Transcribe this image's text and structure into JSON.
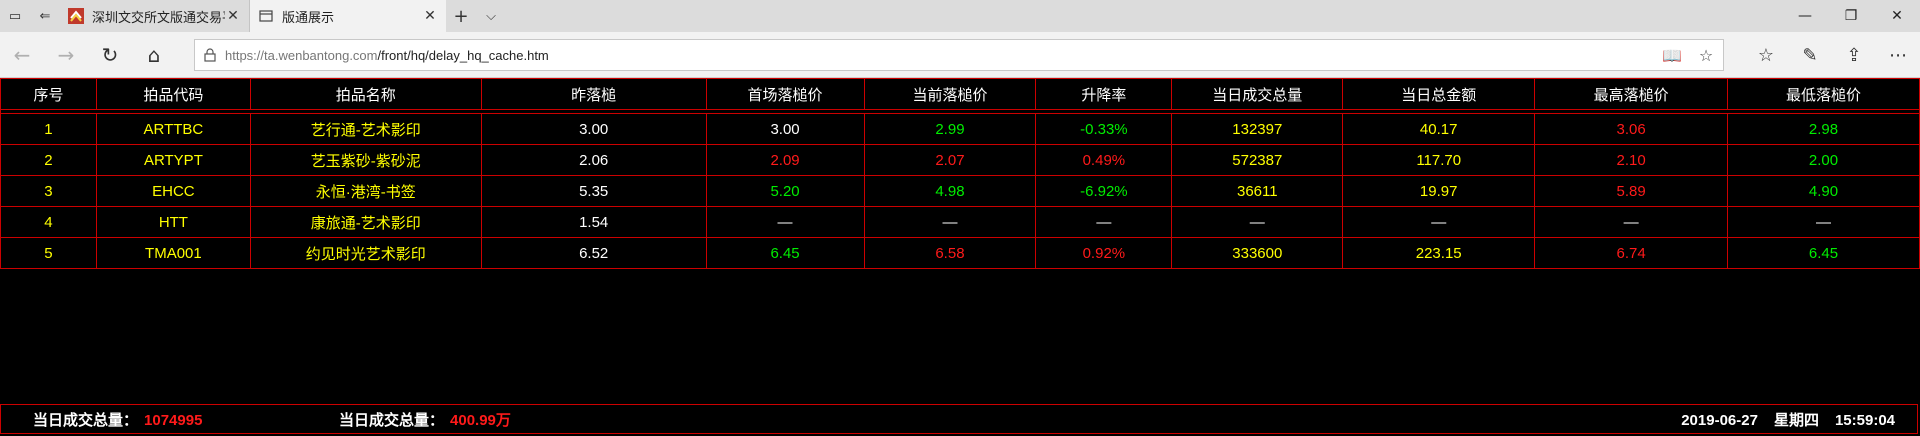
{
  "browser": {
    "tabs": [
      {
        "title": "深圳文交所文版通交易平台",
        "active": false
      },
      {
        "title": "版通展示",
        "active": true
      }
    ],
    "url_host": "https://ta.wenbantong.com",
    "url_path": "/front/hq/delay_hq_cache.htm"
  },
  "table": {
    "headers": [
      "序号",
      "拍品代码",
      "拍品名称",
      "昨落槌",
      "首场落槌价",
      "当前落槌价",
      "升降率",
      "当日成交总量",
      "当日总金额",
      "最高落槌价",
      "最低落槌价"
    ],
    "rows": [
      {
        "cells": [
          "1",
          "ARTTBC",
          "艺行通-艺术影印",
          "3.00",
          "3.00",
          "2.99",
          "-0.33%",
          "132397",
          "40.17",
          "3.06",
          "2.98"
        ],
        "colors": [
          "y",
          "y",
          "y",
          "w",
          "w",
          "g",
          "g",
          "y",
          "y",
          "r",
          "g"
        ]
      },
      {
        "cells": [
          "2",
          "ARTYPT",
          "艺玉紫砂-紫砂泥",
          "2.06",
          "2.09",
          "2.07",
          "0.49%",
          "572387",
          "117.70",
          "2.10",
          "2.00"
        ],
        "colors": [
          "y",
          "y",
          "y",
          "w",
          "r",
          "r",
          "r",
          "y",
          "y",
          "r",
          "g"
        ]
      },
      {
        "cells": [
          "3",
          "EHCC",
          "永恒·港湾-书签",
          "5.35",
          "5.20",
          "4.98",
          "-6.92%",
          "36611",
          "19.97",
          "5.89",
          "4.90"
        ],
        "colors": [
          "y",
          "y",
          "y",
          "w",
          "g",
          "g",
          "g",
          "y",
          "y",
          "r",
          "g"
        ]
      },
      {
        "cells": [
          "4",
          "HTT",
          "康旅通-艺术影印",
          "1.54",
          "—",
          "—",
          "—",
          "—",
          "—",
          "—",
          "—"
        ],
        "colors": [
          "y",
          "y",
          "y",
          "w",
          "w",
          "w",
          "w",
          "w",
          "w",
          "w",
          "w"
        ]
      },
      {
        "cells": [
          "5",
          "TMA001",
          "约见时光艺术影印",
          "6.52",
          "6.45",
          "6.58",
          "0.92%",
          "333600",
          "223.15",
          "6.74",
          "6.45"
        ],
        "colors": [
          "y",
          "y",
          "y",
          "w",
          "g",
          "r",
          "r",
          "y",
          "y",
          "r",
          "g"
        ]
      }
    ]
  },
  "footer": {
    "volume_label": "当日成交总量：",
    "volume_value": "1074995",
    "amount_label": "当日成交总量：",
    "amount_value": "400.99万",
    "date": "2019-06-27",
    "weekday": "星期四",
    "time": "15:59:04"
  }
}
